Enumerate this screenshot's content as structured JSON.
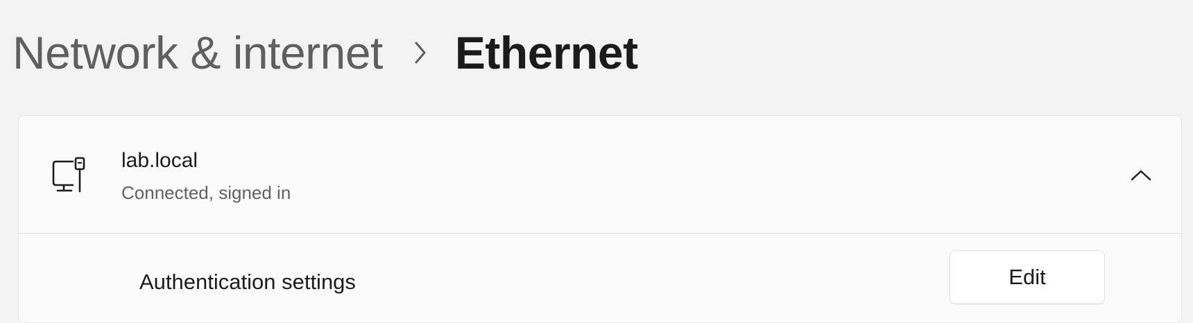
{
  "breadcrumb": {
    "parent": "Network & internet",
    "current": "Ethernet",
    "separator_icon": "chevron-right-icon"
  },
  "network": {
    "icon": "ethernet-computer-icon",
    "name": "lab.local",
    "status": "Connected, signed in",
    "expanded": true,
    "collapse_icon": "chevron-up-icon"
  },
  "settings": {
    "authentication": {
      "label": "Authentication settings",
      "button_label": "Edit"
    }
  }
}
